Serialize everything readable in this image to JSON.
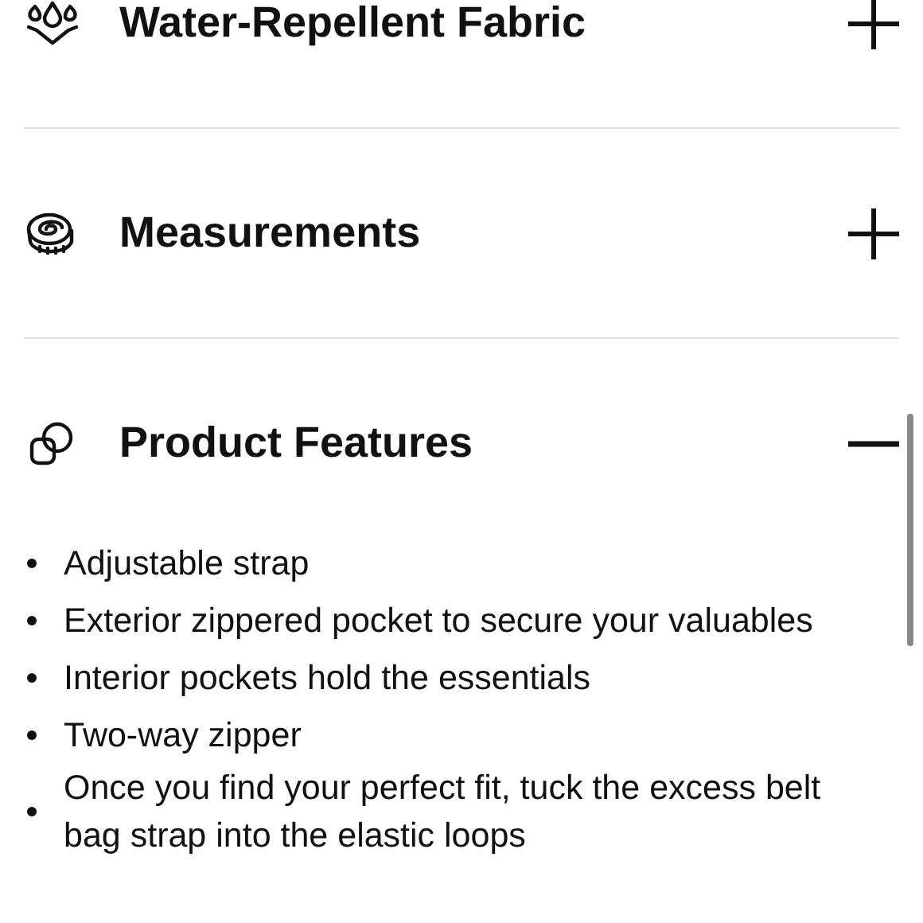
{
  "sections": [
    {
      "title": "Water-Repellent Fabric",
      "expanded": false
    },
    {
      "title": "Measurements",
      "expanded": false
    },
    {
      "title": "Product Features",
      "expanded": true,
      "items": [
        "Adjustable strap",
        "Exterior zippered pocket to secure your valuables",
        "Interior pockets hold the essentials",
        "Two-way zipper",
        "Once you find your perfect fit, tuck the excess belt bag strap into the elastic loops"
      ]
    }
  ]
}
